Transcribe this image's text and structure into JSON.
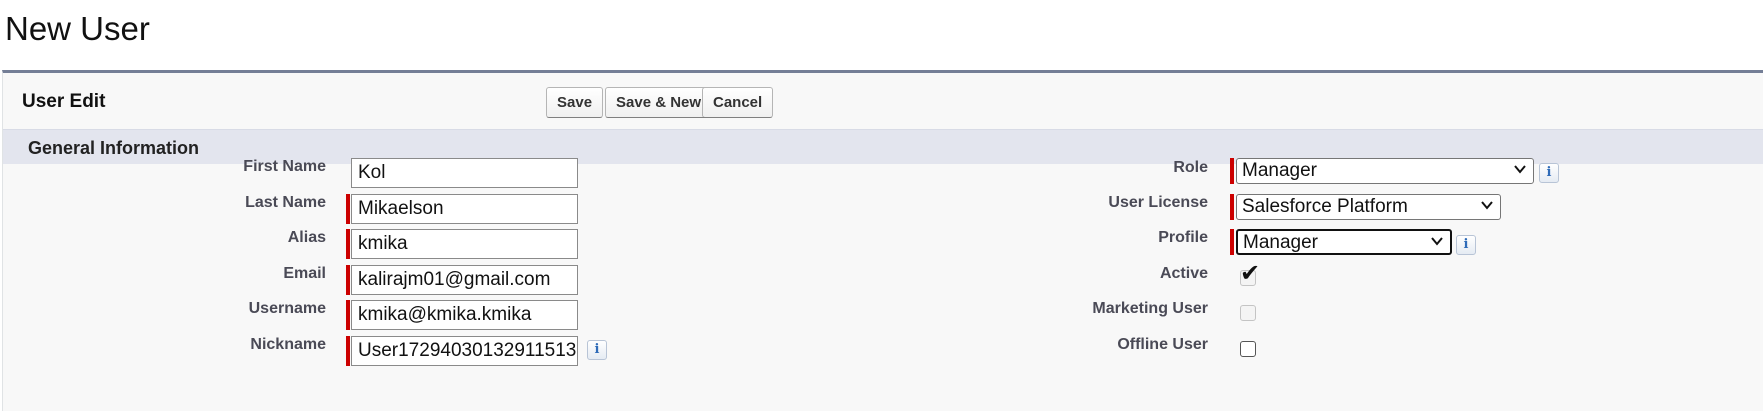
{
  "page": {
    "title": "New User"
  },
  "panel": {
    "title": "User Edit",
    "buttons": {
      "save": "Save",
      "save_new": "Save & New",
      "cancel": "Cancel"
    }
  },
  "section": {
    "title": "General Information"
  },
  "left_fields": {
    "first_name": {
      "label": "First Name",
      "value": "Kol",
      "required": false
    },
    "last_name": {
      "label": "Last Name",
      "value": "Mikaelson",
      "required": true
    },
    "alias": {
      "label": "Alias",
      "value": "kmika",
      "required": true
    },
    "email": {
      "label": "Email",
      "value": "kalirajm01@gmail.com",
      "required": true
    },
    "username": {
      "label": "Username",
      "value": "kmika@kmika.kmika",
      "required": true
    },
    "nickname": {
      "label": "Nickname",
      "value": "User17294030132911513",
      "required": true,
      "info_icon": "i"
    }
  },
  "right_fields": {
    "role": {
      "label": "Role",
      "value": "Manager",
      "info_icon": "i"
    },
    "user_license": {
      "label": "User License",
      "value": "Salesforce Platform"
    },
    "profile": {
      "label": "Profile",
      "value": "Manager",
      "info_icon": "i"
    },
    "active": {
      "label": "Active",
      "checked": true
    },
    "marketing_user": {
      "label": "Marketing User",
      "checked": false,
      "disabled": true
    },
    "offline_user": {
      "label": "Offline User",
      "checked": false
    }
  },
  "icons": {
    "info": "info-icon",
    "chevron": "chevron-down-icon",
    "check": "checkmark-icon"
  },
  "colors": {
    "required": "#cc0000",
    "panel_border": "#747e96",
    "section_bg": "#e3e5ee"
  }
}
